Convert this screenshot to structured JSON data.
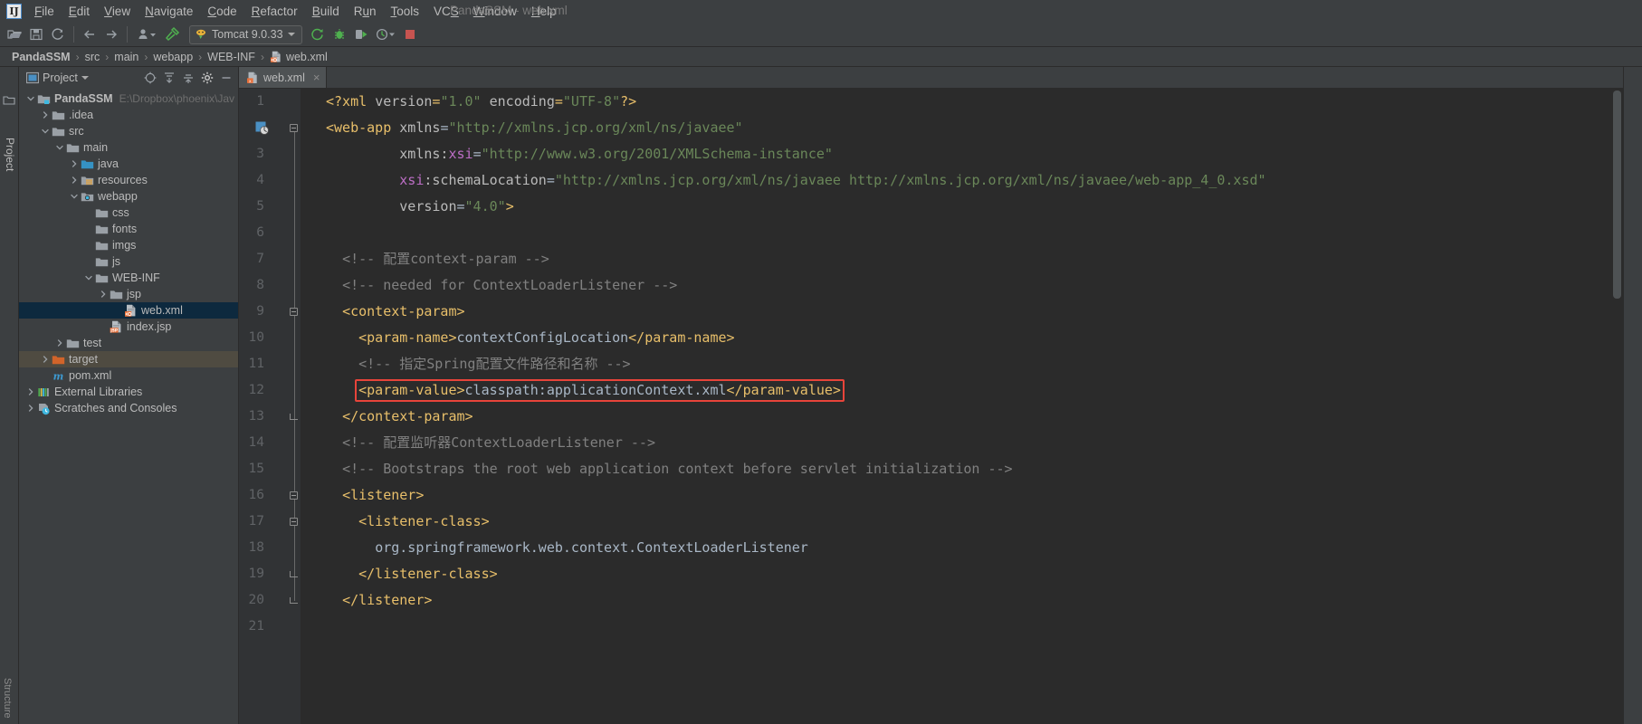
{
  "window": {
    "title": "PandaSSM - web.xml",
    "logo_text": "IJ"
  },
  "menubar": {
    "items": [
      {
        "label": "File",
        "mnemonic": "F"
      },
      {
        "label": "Edit",
        "mnemonic": "E"
      },
      {
        "label": "View",
        "mnemonic": "V"
      },
      {
        "label": "Navigate",
        "mnemonic": "N"
      },
      {
        "label": "Code",
        "mnemonic": "C"
      },
      {
        "label": "Refactor",
        "mnemonic": "R"
      },
      {
        "label": "Build",
        "mnemonic": "B"
      },
      {
        "label": "Run",
        "mnemonic": "u"
      },
      {
        "label": "Tools",
        "mnemonic": "T"
      },
      {
        "label": "VCS",
        "mnemonic": "S"
      },
      {
        "label": "Window",
        "mnemonic": "W"
      },
      {
        "label": "Help",
        "mnemonic": "H"
      }
    ]
  },
  "toolbar": {
    "open_icon": "open-folder-icon",
    "save_icon": "save-icon",
    "sync_icon": "sync-icon",
    "back_icon": "arrow-back-icon",
    "forward_icon": "arrow-forward-icon",
    "profile_icon": "user-profile-icon",
    "build_icon": "hammer-build-icon",
    "run_config_label": "Tomcat 9.0.33",
    "run_config_icon": "tomcat-icon",
    "run_icon": "run-icon",
    "debug_icon": "debug-bug-icon",
    "run_coverage_icon": "run-with-coverage-icon",
    "profiler_icon": "profiler-icon",
    "stop_icon": "stop-icon"
  },
  "breadcrumb": {
    "separator": "›",
    "items": [
      {
        "label": "PandaSSM",
        "bold": true,
        "icon": null
      },
      {
        "label": "src",
        "bold": false,
        "icon": null
      },
      {
        "label": "main",
        "bold": false,
        "icon": null
      },
      {
        "label": "webapp",
        "bold": false,
        "icon": null
      },
      {
        "label": "WEB-INF",
        "bold": false,
        "icon": null
      },
      {
        "label": "web.xml",
        "bold": false,
        "icon": "xml-file-icon"
      }
    ]
  },
  "left_strip": {
    "project_tab": "Project",
    "structure_tab": "Structure",
    "favorites_icon": "favorites-icon"
  },
  "project_panel": {
    "title": "Project",
    "view_icon": "project-view-icon",
    "dropdown_icon": "chevron-down-icon",
    "tools": [
      {
        "name": "scroll-from-source-icon"
      },
      {
        "name": "collapse-all-icon"
      },
      {
        "name": "expand-all-icon"
      },
      {
        "name": "settings-gear-icon"
      },
      {
        "name": "hide-panel-icon"
      }
    ],
    "tree": [
      {
        "label": "PandaSSM",
        "path": "E:\\Dropbox\\phoenix\\JavaPro",
        "depth": 0,
        "twist": "down",
        "icon": "module-folder-icon",
        "bold": true,
        "state": "none"
      },
      {
        "label": ".idea",
        "path": "",
        "depth": 1,
        "twist": "right",
        "icon": "folder-icon",
        "bold": false,
        "state": "none"
      },
      {
        "label": "src",
        "path": "",
        "depth": 1,
        "twist": "down",
        "icon": "folder-icon",
        "bold": false,
        "state": "none"
      },
      {
        "label": "main",
        "path": "",
        "depth": 2,
        "twist": "down",
        "icon": "folder-icon",
        "bold": false,
        "state": "none"
      },
      {
        "label": "java",
        "path": "",
        "depth": 3,
        "twist": "right",
        "icon": "source-folder-icon",
        "bold": false,
        "state": "none"
      },
      {
        "label": "resources",
        "path": "",
        "depth": 3,
        "twist": "right",
        "icon": "resources-folder-icon",
        "bold": false,
        "state": "none"
      },
      {
        "label": "webapp",
        "path": "",
        "depth": 3,
        "twist": "down",
        "icon": "web-folder-icon",
        "bold": false,
        "state": "none"
      },
      {
        "label": "css",
        "path": "",
        "depth": 4,
        "twist": "none",
        "icon": "folder-icon",
        "bold": false,
        "state": "none"
      },
      {
        "label": "fonts",
        "path": "",
        "depth": 4,
        "twist": "none",
        "icon": "folder-icon",
        "bold": false,
        "state": "none"
      },
      {
        "label": "imgs",
        "path": "",
        "depth": 4,
        "twist": "none",
        "icon": "folder-icon",
        "bold": false,
        "state": "none"
      },
      {
        "label": "js",
        "path": "",
        "depth": 4,
        "twist": "none",
        "icon": "folder-icon",
        "bold": false,
        "state": "none"
      },
      {
        "label": "WEB-INF",
        "path": "",
        "depth": 4,
        "twist": "down",
        "icon": "folder-icon",
        "bold": false,
        "state": "none"
      },
      {
        "label": "jsp",
        "path": "",
        "depth": 5,
        "twist": "right",
        "icon": "folder-icon",
        "bold": false,
        "state": "none"
      },
      {
        "label": "web.xml",
        "path": "",
        "depth": 6,
        "twist": "none",
        "icon": "xml-file-icon",
        "bold": false,
        "state": "selected"
      },
      {
        "label": "index.jsp",
        "path": "",
        "depth": 5,
        "twist": "none",
        "icon": "jsp-file-icon",
        "bold": false,
        "state": "none"
      },
      {
        "label": "test",
        "path": "",
        "depth": 2,
        "twist": "right",
        "icon": "folder-icon",
        "bold": false,
        "state": "none"
      },
      {
        "label": "target",
        "path": "",
        "depth": 1,
        "twist": "right",
        "icon": "excluded-folder-icon",
        "bold": false,
        "state": "highlighted"
      },
      {
        "label": "pom.xml",
        "path": "",
        "depth": 1,
        "twist": "none",
        "icon": "maven-pom-icon",
        "bold": false,
        "state": "none"
      },
      {
        "label": "External Libraries",
        "path": "",
        "depth": 0,
        "twist": "right",
        "icon": "libraries-icon",
        "bold": false,
        "state": "none"
      },
      {
        "label": "Scratches and Consoles",
        "path": "",
        "depth": 0,
        "twist": "right",
        "icon": "scratches-icon",
        "bold": false,
        "state": "none"
      }
    ]
  },
  "editor": {
    "tabs": [
      {
        "label": "web.xml",
        "icon": "xml-file-icon",
        "active": true,
        "close": "×"
      }
    ],
    "first_line": 1,
    "last_line": 21,
    "line_numbers": [
      1,
      2,
      3,
      4,
      5,
      6,
      7,
      8,
      9,
      10,
      11,
      12,
      13,
      14,
      15,
      16,
      17,
      18,
      19,
      20,
      21
    ],
    "highlight_box": {
      "line": 12,
      "color": "#e8443a"
    },
    "lines": [
      {
        "n": 1,
        "tokens": [
          {
            "t": "pi",
            "s": "<?xml "
          },
          {
            "t": "attr",
            "s": "version"
          },
          {
            "t": "pi",
            "s": "="
          },
          {
            "t": "str",
            "s": "\"1.0\""
          },
          {
            "t": "pi",
            "s": " "
          },
          {
            "t": "attr",
            "s": "encoding"
          },
          {
            "t": "pi",
            "s": "="
          },
          {
            "t": "str",
            "s": "\"UTF-8\""
          },
          {
            "t": "pi",
            "s": "?>"
          }
        ]
      },
      {
        "n": 2,
        "tokens": [
          {
            "t": "tag",
            "s": "<web-app "
          },
          {
            "t": "attr",
            "s": "xmlns"
          },
          {
            "t": "txt",
            "s": "="
          },
          {
            "t": "str",
            "s": "\"http://xmlns.jcp.org/xml/ns/javaee\""
          }
        ]
      },
      {
        "n": 3,
        "tokens": [
          {
            "t": "txt",
            "s": "         "
          },
          {
            "t": "attr",
            "s": "xmlns:"
          },
          {
            "t": "attrns",
            "s": "xsi"
          },
          {
            "t": "txt",
            "s": "="
          },
          {
            "t": "str",
            "s": "\"http://www.w3.org/2001/XMLSchema-instance\""
          }
        ]
      },
      {
        "n": 4,
        "tokens": [
          {
            "t": "txt",
            "s": "         "
          },
          {
            "t": "attrns",
            "s": "xsi"
          },
          {
            "t": "attr",
            "s": ":schemaLocation"
          },
          {
            "t": "txt",
            "s": "="
          },
          {
            "t": "str",
            "s": "\"http://xmlns.jcp.org/xml/ns/javaee http://xmlns.jcp.org/xml/ns/javaee/web-app_4_0.xsd\""
          }
        ]
      },
      {
        "n": 5,
        "tokens": [
          {
            "t": "txt",
            "s": "         "
          },
          {
            "t": "attr",
            "s": "version"
          },
          {
            "t": "txt",
            "s": "="
          },
          {
            "t": "str",
            "s": "\"4.0\""
          },
          {
            "t": "tag",
            "s": ">"
          }
        ]
      },
      {
        "n": 6,
        "tokens": []
      },
      {
        "n": 7,
        "tokens": [
          {
            "t": "txt",
            "s": "  "
          },
          {
            "t": "cmt",
            "s": "<!-- 配置context-param -->"
          }
        ]
      },
      {
        "n": 8,
        "tokens": [
          {
            "t": "txt",
            "s": "  "
          },
          {
            "t": "cmt",
            "s": "<!-- needed for ContextLoaderListener -->"
          }
        ]
      },
      {
        "n": 9,
        "tokens": [
          {
            "t": "txt",
            "s": "  "
          },
          {
            "t": "tag",
            "s": "<context-param>"
          }
        ]
      },
      {
        "n": 10,
        "tokens": [
          {
            "t": "txt",
            "s": "    "
          },
          {
            "t": "tag",
            "s": "<param-name>"
          },
          {
            "t": "txt",
            "s": "contextConfigLocation"
          },
          {
            "t": "tag",
            "s": "</param-name>"
          }
        ]
      },
      {
        "n": 11,
        "tokens": [
          {
            "t": "txt",
            "s": "    "
          },
          {
            "t": "cmt",
            "s": "<!-- 指定Spring配置文件路径和名称 -->"
          }
        ]
      },
      {
        "n": 12,
        "tokens": [
          {
            "t": "txt",
            "s": "    "
          },
          {
            "t": "tag",
            "s": "<param-value>"
          },
          {
            "t": "txt",
            "s": "classpath:applicationContext.xml"
          },
          {
            "t": "tag",
            "s": "</param-value>"
          }
        ]
      },
      {
        "n": 13,
        "tokens": [
          {
            "t": "txt",
            "s": "  "
          },
          {
            "t": "tag",
            "s": "</context-param>"
          }
        ]
      },
      {
        "n": 14,
        "tokens": [
          {
            "t": "txt",
            "s": "  "
          },
          {
            "t": "cmt",
            "s": "<!-- 配置监听器ContextLoaderListener -->"
          }
        ]
      },
      {
        "n": 15,
        "tokens": [
          {
            "t": "txt",
            "s": "  "
          },
          {
            "t": "cmt",
            "s": "<!-- Bootstraps the root web application context before servlet initialization -->"
          }
        ]
      },
      {
        "n": 16,
        "tokens": [
          {
            "t": "txt",
            "s": "  "
          },
          {
            "t": "tag",
            "s": "<listener>"
          }
        ]
      },
      {
        "n": 17,
        "tokens": [
          {
            "t": "txt",
            "s": "    "
          },
          {
            "t": "tag",
            "s": "<listener-class>"
          }
        ]
      },
      {
        "n": 18,
        "tokens": [
          {
            "t": "txt",
            "s": "      "
          },
          {
            "t": "txt",
            "s": "org.springframework.web.context.ContextLoaderListener"
          }
        ]
      },
      {
        "n": 19,
        "tokens": [
          {
            "t": "txt",
            "s": "    "
          },
          {
            "t": "tag",
            "s": "</listener-class>"
          }
        ]
      },
      {
        "n": 20,
        "tokens": [
          {
            "t": "txt",
            "s": "  "
          },
          {
            "t": "tag",
            "s": "</listener>"
          }
        ]
      },
      {
        "n": 21,
        "tokens": []
      }
    ],
    "gutter_icons": [
      {
        "line": 2,
        "name": "web-deployment-descriptor-icon"
      }
    ],
    "fold_markers": [
      {
        "line": 2,
        "type": "open"
      },
      {
        "line": 9,
        "type": "open"
      },
      {
        "line": 13,
        "type": "close"
      },
      {
        "line": 16,
        "type": "open"
      },
      {
        "line": 17,
        "type": "open"
      },
      {
        "line": 19,
        "type": "close"
      },
      {
        "line": 20,
        "type": "close"
      }
    ]
  },
  "colors": {
    "bg_panel": "#3c3f41",
    "bg_editor": "#2b2b2b",
    "bg_gutter": "#313335",
    "tag": "#e8bf6a",
    "string": "#6a8759",
    "comment": "#808080",
    "text": "#a9b7c6",
    "ns": "#bc6ec5",
    "selection": "#0d293e",
    "highlight_red": "#e8443a",
    "excluded": "#4f4b41"
  }
}
